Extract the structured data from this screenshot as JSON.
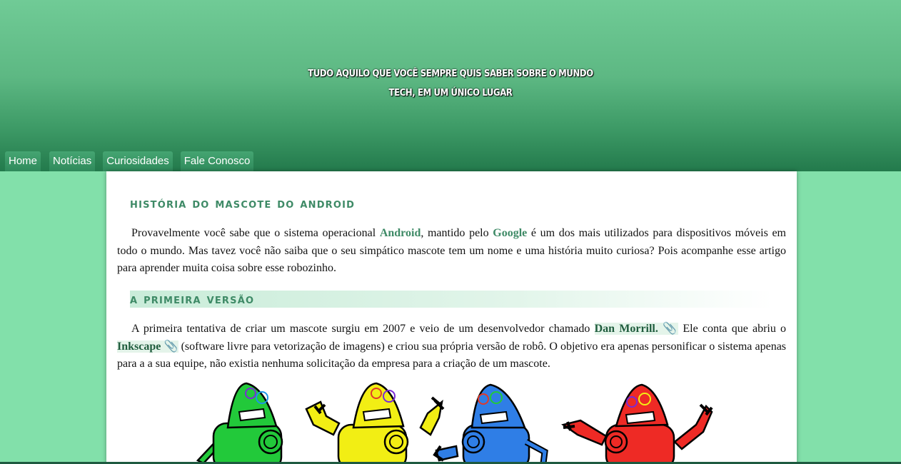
{
  "header": {
    "tagline_line1": "TUDO AQUILO QUE VOCÊ SEMPRE QUIS SABER SOBRE O MUNDO",
    "tagline_line2": "TECH, EM UM ÚNICO LUGAR"
  },
  "nav": {
    "items": [
      "Home",
      "Notícias",
      "Curiosidades",
      "Fale Conosco"
    ]
  },
  "article": {
    "title": "História do mascote do Android",
    "p1_a": "Provavelmente você sabe que o sistema operacional ",
    "p1_android": "Android",
    "p1_b": ", mantido pelo ",
    "p1_google": "Google",
    "p1_c": " é um dos mais utilizados para dispositivos móveis em todo o mundo. Mas tavez você não saiba que o seu simpático mascote tem um nome e uma história muito curiosa? Pois acompanhe esse artigo para aprender muita coisa sobre esse robozinho.",
    "section_title": "A primeira versão",
    "p2_a": "A primeira tentativa de criar um mascote surgiu em 2007 e veio de um desenvolvedor chamado ",
    "p2_link1": "Dan Morrill.",
    "p2_b": " Ele conta que abriu o ",
    "p2_link2": "Inkscape",
    "p2_c": " (software livre para vetorização de imagens) e criou sua própria versão de robô. O objetivo era apenas personificar o sistema apenas para a a sua equipe, não existia nenhuma solicitação da empresa para a criação de um mascote."
  },
  "icons": {
    "link": "paperclip-icon"
  },
  "colors": {
    "accent": "#3e8a66",
    "page_bg": "#82e0aa",
    "header_top": "#70cb96",
    "header_bottom": "#237a4c",
    "robot_green": "#22c93a",
    "robot_yellow": "#f2ee14",
    "robot_blue": "#2f7ee6",
    "robot_red": "#ee2a25"
  }
}
